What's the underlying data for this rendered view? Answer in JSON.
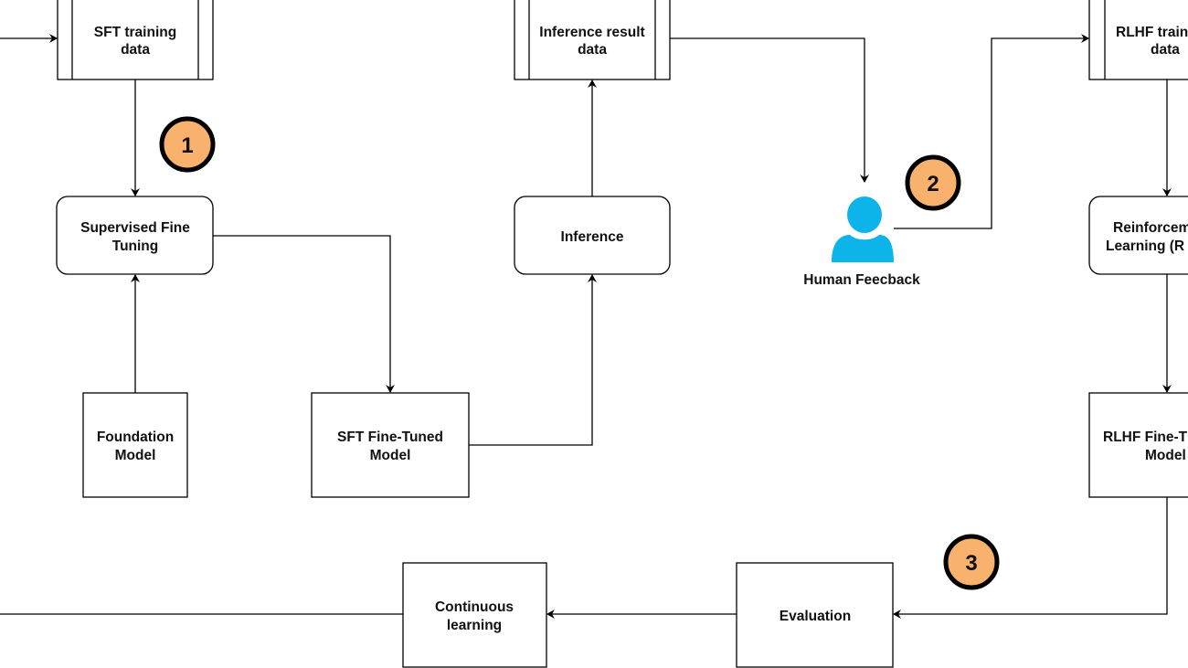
{
  "nodes": {
    "sft_data": [
      "SFT training",
      "data"
    ],
    "inference_data": [
      "Inference result",
      "data"
    ],
    "rlhf_data": [
      "RLHF traini",
      "data"
    ],
    "sft": [
      "Supervised Fine",
      "Tuning"
    ],
    "inference": [
      "Inference"
    ],
    "rl": [
      "Reinforcem",
      "Learning (R"
    ],
    "foundation": [
      "Foundation",
      "Model"
    ],
    "sft_model": [
      "SFT Fine-Tuned",
      "Model"
    ],
    "rlhf_model": [
      "RLHF Fine-T",
      "Model"
    ],
    "continuous": [
      "Continuous",
      "learning"
    ],
    "evaluation": [
      "Evaluation"
    ],
    "human": "Human Feecback"
  },
  "steps": [
    "1",
    "2",
    "3"
  ],
  "colors": {
    "step_fill": "#f9b26d",
    "person": "#0db4ea",
    "line": "#000000"
  },
  "icons": {
    "human": "person-icon"
  }
}
